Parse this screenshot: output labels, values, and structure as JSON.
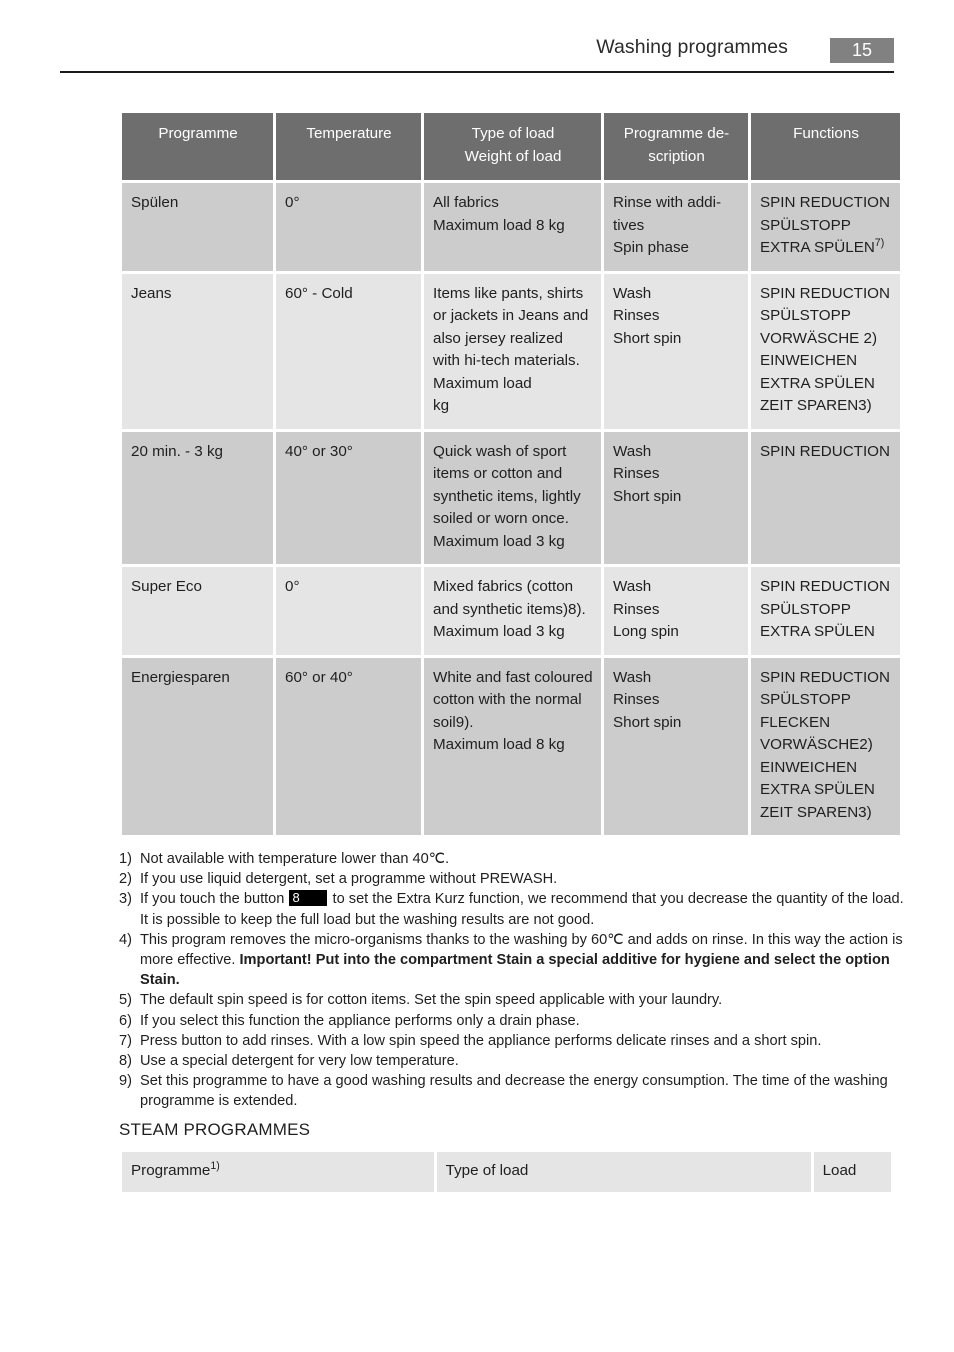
{
  "header": {
    "title": "Washing programmes",
    "page_number": "15"
  },
  "programme_table": {
    "columns": [
      "Programme",
      "Temperature",
      "Type of load\nWeight of load",
      "Programme de-scription",
      "Functions"
    ],
    "column_headers": {
      "programme": "Programme",
      "temperature": "Temperature",
      "type_of_load_line1": "Type of load",
      "type_of_load_line2": "Weight of load",
      "description_line1": "Programme de-",
      "description_line2": "scription",
      "functions": "Functions"
    },
    "rows": [
      {
        "programme": "Spülen",
        "temperature": "0°",
        "type_of_load": "All fabrics\nMaximum load 8 kg",
        "type_of_load_lines": [
          "All fabrics",
          "Maximum load 8 kg"
        ],
        "description": "Rinse with additives\nSpin phase",
        "description_lines": [
          "Rinse with addi-",
          "tives",
          "Spin phase"
        ],
        "functions": [
          "SPIN REDUCTION",
          "SPÜLSTOPP",
          "EXTRA SPÜLEN"
        ],
        "functions_footnote": "7)"
      },
      {
        "programme": "Jeans",
        "temperature": "60° - Cold",
        "type_of_load": "Items like pants, shirts or jackets in Jeans and also jersey realized with hi-tech materials.\nMaximum load\nkg",
        "type_of_load_lines": [
          "Items like pants, shirts or jackets in Jeans and also jersey realized with hi-tech materials.",
          "Maximum load",
          "kg"
        ],
        "description": "Wash\nRinses\nShort spin",
        "description_lines": [
          "Wash",
          "Rinses",
          "Short spin"
        ],
        "functions": [
          "SPIN REDUCTION",
          "SPÜLSTOPP",
          "VORWÄSCHE 2)",
          "EINWEICHEN",
          "EXTRA SPÜLEN",
          "ZEIT SPAREN3)"
        ]
      },
      {
        "programme": "20 min. - 3 kg",
        "temperature": "40° or 30°",
        "type_of_load": "Quick wash of sport items or cotton and synthetic items, lightly soiled or worn once.\nMaximum load 3 kg",
        "type_of_load_lines": [
          "Quick wash of sport items or cotton and synthetic items, lightly soiled or worn once.",
          "Maximum load 3 kg"
        ],
        "description": "Wash\nRinses\nShort spin",
        "description_lines": [
          "Wash",
          "Rinses",
          "Short spin"
        ],
        "functions": [
          "SPIN REDUCTION"
        ]
      },
      {
        "programme": "Super Eco",
        "temperature": "0°",
        "type_of_load": "Mixed fabrics (cotton and synthetic items)8).\nMaximum load 3 kg",
        "type_of_load_lines": [
          "Mixed fabrics (cotton and synthetic items)8).",
          "Maximum load 3 kg"
        ],
        "description": "Wash\nRinses\nLong spin",
        "description_lines": [
          "Wash",
          "Rinses",
          "Long spin"
        ],
        "functions": [
          "SPIN REDUCTION",
          "SPÜLSTOPP",
          "EXTRA SPÜLEN"
        ]
      },
      {
        "programme": "Energiesparen",
        "temperature": "60° or 40°",
        "type_of_load": "White and fast coloured cotton with the normal soil9).\nMaximum load 8 kg",
        "type_of_load_lines": [
          "White and fast coloured cotton with the normal soil9).",
          "Maximum load 8 kg"
        ],
        "description": "Wash\nRinses\nShort spin",
        "description_lines": [
          "Wash",
          "Rinses",
          "Short spin"
        ],
        "functions": [
          "SPIN REDUCTION",
          "SPÜLSTOPP",
          "FLECKEN",
          "VORWÄSCHE2)",
          "EINWEICHEN",
          "EXTRA SPÜLEN",
          "ZEIT SPAREN3)"
        ]
      }
    ]
  },
  "footnotes": [
    {
      "num": "1)",
      "text": "Not available with temperature lower than 40℃."
    },
    {
      "num": "2)",
      "text": "If you use liquid detergent, set a programme without PREWASH."
    },
    {
      "num": "3)",
      "text_before_button": "If you touch the button",
      "button_label": "8",
      "text_after_button": "to set the Extra Kurz function, we recommend that you decrease the quantity of the load. It is possible to keep the full load but the washing results are not good."
    },
    {
      "num": "4)",
      "text_normal_1": "This program removes the micro-organisms thanks to the washing by 60℃ and adds on rinse. In this way the action is more effective. ",
      "text_bold": "Important! Put into the compartment Stain a special additive for hygiene and select the option Stain."
    },
    {
      "num": "5)",
      "text": "The default spin speed is for cotton items. Set the spin speed applicable with your laundry."
    },
    {
      "num": "6)",
      "text": "If you select this function the appliance performs only a drain phase."
    },
    {
      "num": "7)",
      "text": "Press button to add rinses. With a low spin speed the appliance performs delicate rinses and a short spin."
    },
    {
      "num": "8)",
      "text": "Use a special detergent for very low temperature."
    },
    {
      "num": "9)",
      "text": "Set this programme to have a good washing results and decrease the energy consumption. The time of the washing programme is extended."
    }
  ],
  "steam_section": {
    "title": "STEAM PROGRAMMES",
    "columns": {
      "programme": "Programme",
      "programme_footnote": "1)",
      "type_of_load": "Type of load",
      "load": "Load"
    }
  },
  "colors": {
    "header_row_bg": "#6e6e6e",
    "row_odd_bg": "#cccccc",
    "row_even_bg": "#e5e5e5",
    "page_badge_bg": "#818181",
    "text": "#1f1f1f",
    "inline_button_bg": "#000000"
  }
}
